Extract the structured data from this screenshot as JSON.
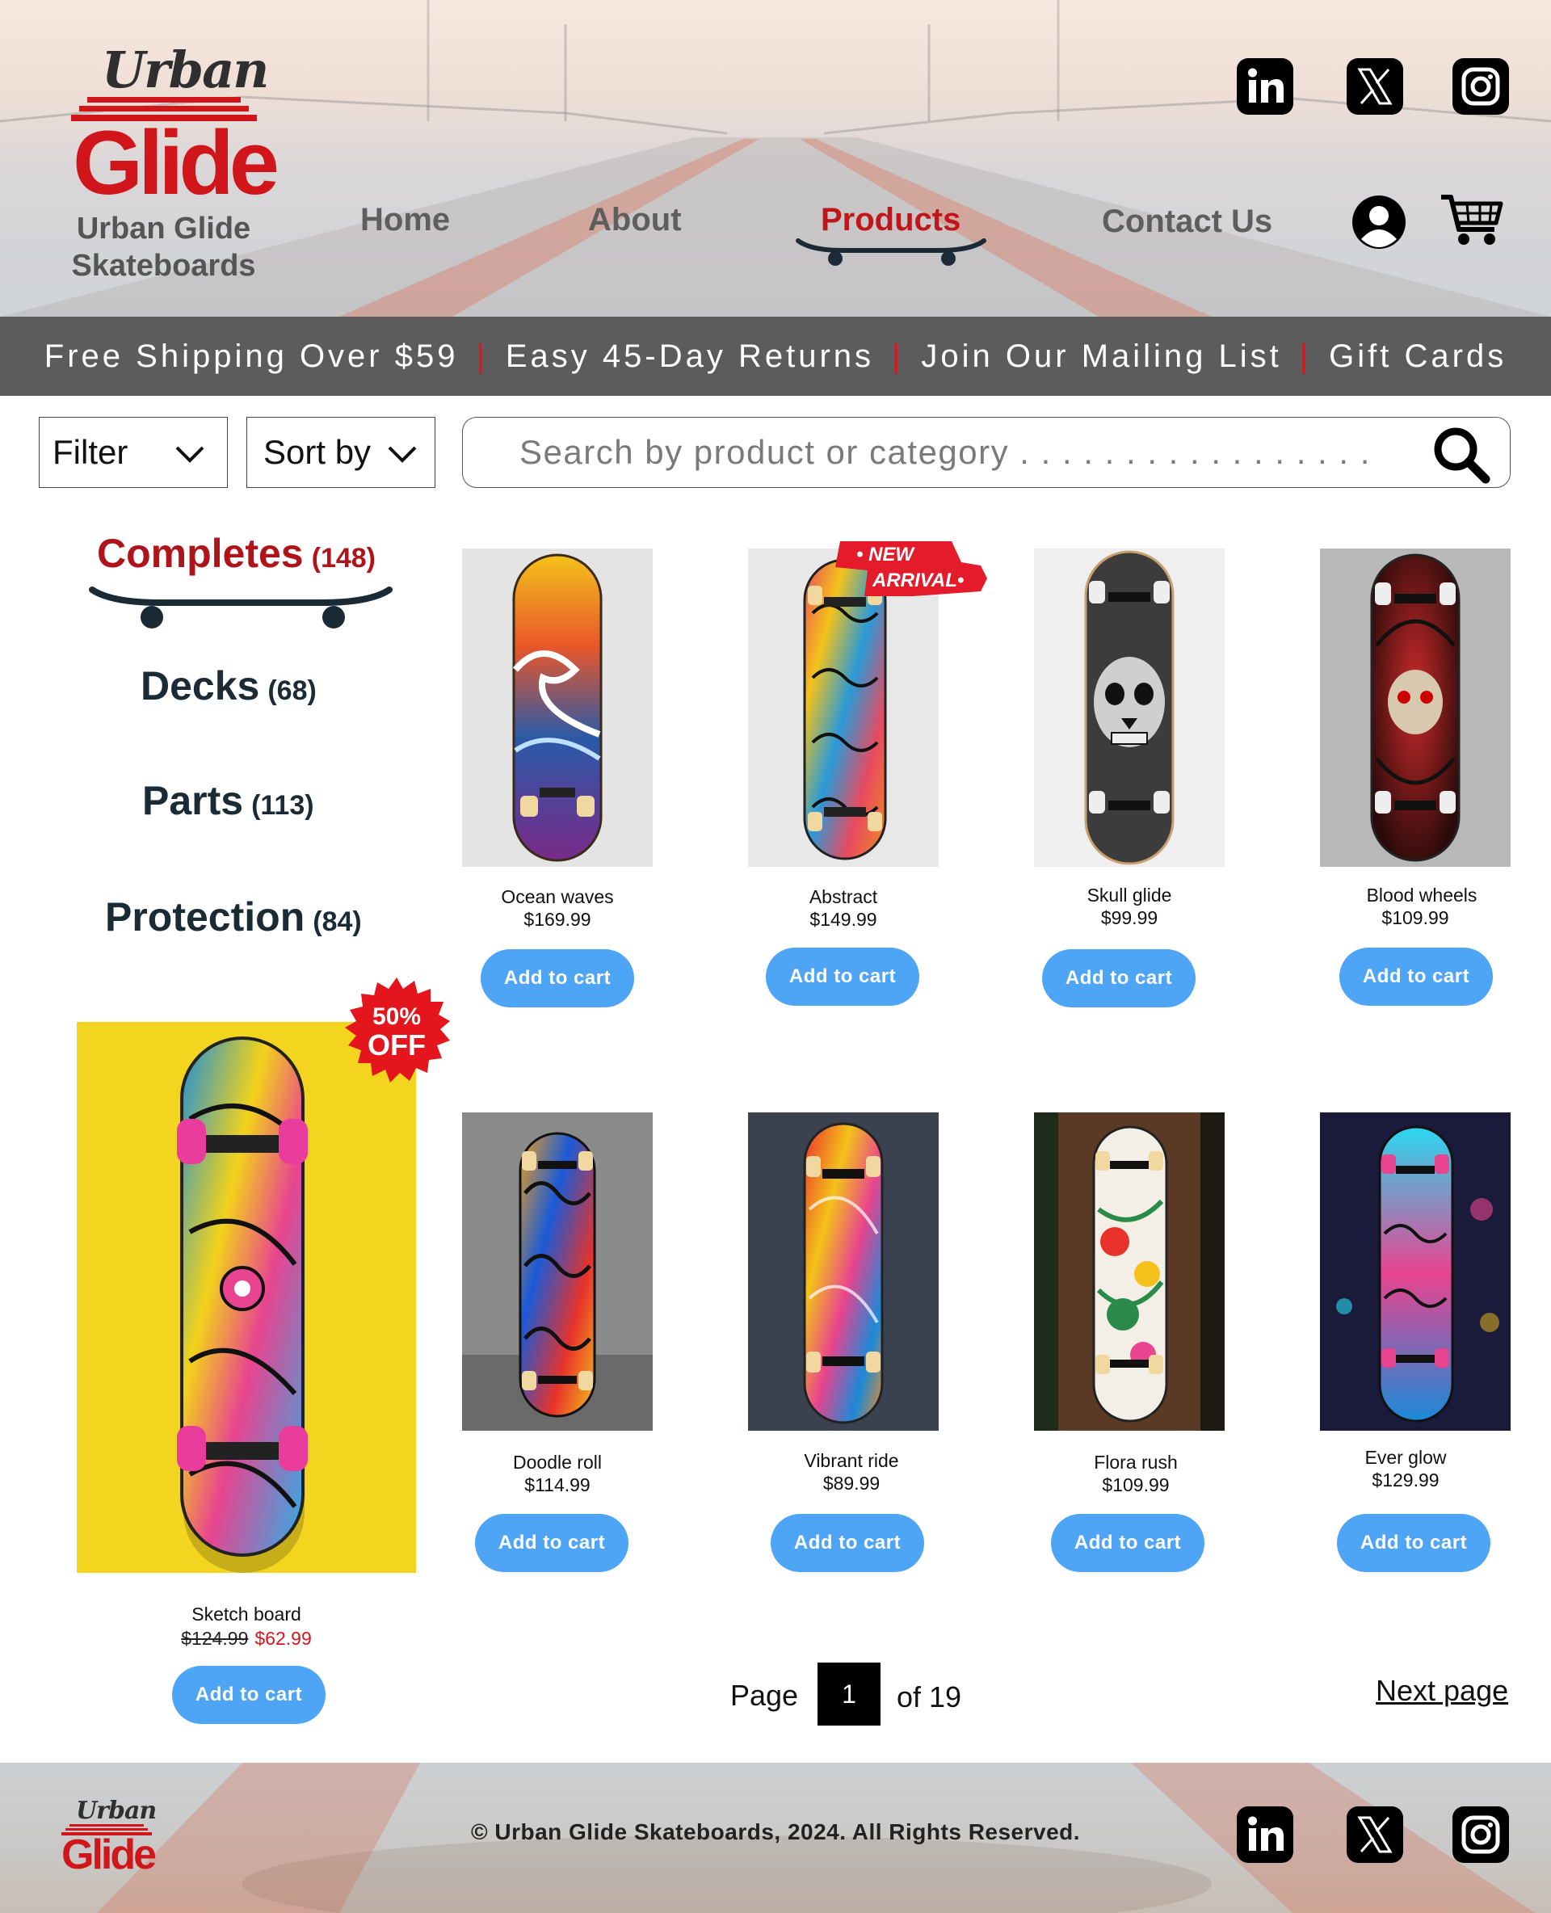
{
  "brand": {
    "logo_top": "Urban",
    "logo_main": "Glide",
    "name_line1": "Urban Glide",
    "name_line2": "Skateboards"
  },
  "nav": {
    "home": "Home",
    "about": "About",
    "products": "Products",
    "contact": "Contact Us",
    "active": "Products"
  },
  "header_icons": [
    "linkedin-icon",
    "x-icon",
    "instagram-icon",
    "account-icon",
    "cart-icon"
  ],
  "promo": {
    "items": [
      "Free Shipping Over $59",
      "Easy 45-Day Returns",
      "Join Our Mailing List",
      "Gift Cards"
    ],
    "separator": "|"
  },
  "controls": {
    "filter_label": "Filter",
    "sort_label": "Sort by",
    "search_placeholder": "Search by product or category . . . . . . . . . . . . . . . . . ."
  },
  "categories": [
    {
      "label": "Completes",
      "count": "(148)",
      "active": true
    },
    {
      "label": "Decks",
      "count": "(68)"
    },
    {
      "label": "Parts",
      "count": "(113)"
    },
    {
      "label": "Protection",
      "count": "(84)"
    }
  ],
  "badges": {
    "new_line1": "• NEW",
    "new_line2": "ARRIVAL•",
    "sale_line1": "50%",
    "sale_line2": "OFF"
  },
  "products": [
    {
      "name": "Ocean waves",
      "price": "$169.99",
      "button": "Add to cart"
    },
    {
      "name": "Abstract",
      "price": "$149.99",
      "button": "Add to cart"
    },
    {
      "name": "Skull glide",
      "price": "$99.99",
      "button": "Add to cart"
    },
    {
      "name": "Blood wheels",
      "price": "$109.99",
      "button": "Add to cart"
    },
    {
      "name": "Doodle roll",
      "price": "$114.99",
      "button": "Add to cart"
    },
    {
      "name": "Vibrant ride",
      "price": "$89.99",
      "button": "Add to cart"
    },
    {
      "name": "Flora rush",
      "price": "$109.99",
      "button": "Add to cart"
    },
    {
      "name": "Ever glow",
      "price": "$129.99",
      "button": "Add to cart"
    }
  ],
  "featured": {
    "name": "Sketch board",
    "old_price": "$124.99",
    "new_price": "$62.99",
    "button": "Add to cart"
  },
  "pagination": {
    "page_label": "Page",
    "current": "1",
    "of_label": "of 19",
    "next": "Next page"
  },
  "footer": {
    "logo_top": "Urban",
    "logo_main": "Glide",
    "copyright": "© Urban Glide Skateboards, 2024. All Rights Reserved."
  },
  "colors": {
    "brand_red": "#d0161b",
    "button_blue": "#4ea5f5",
    "promo_bar": "#5c5c5c",
    "category_text": "#1b2b36"
  }
}
